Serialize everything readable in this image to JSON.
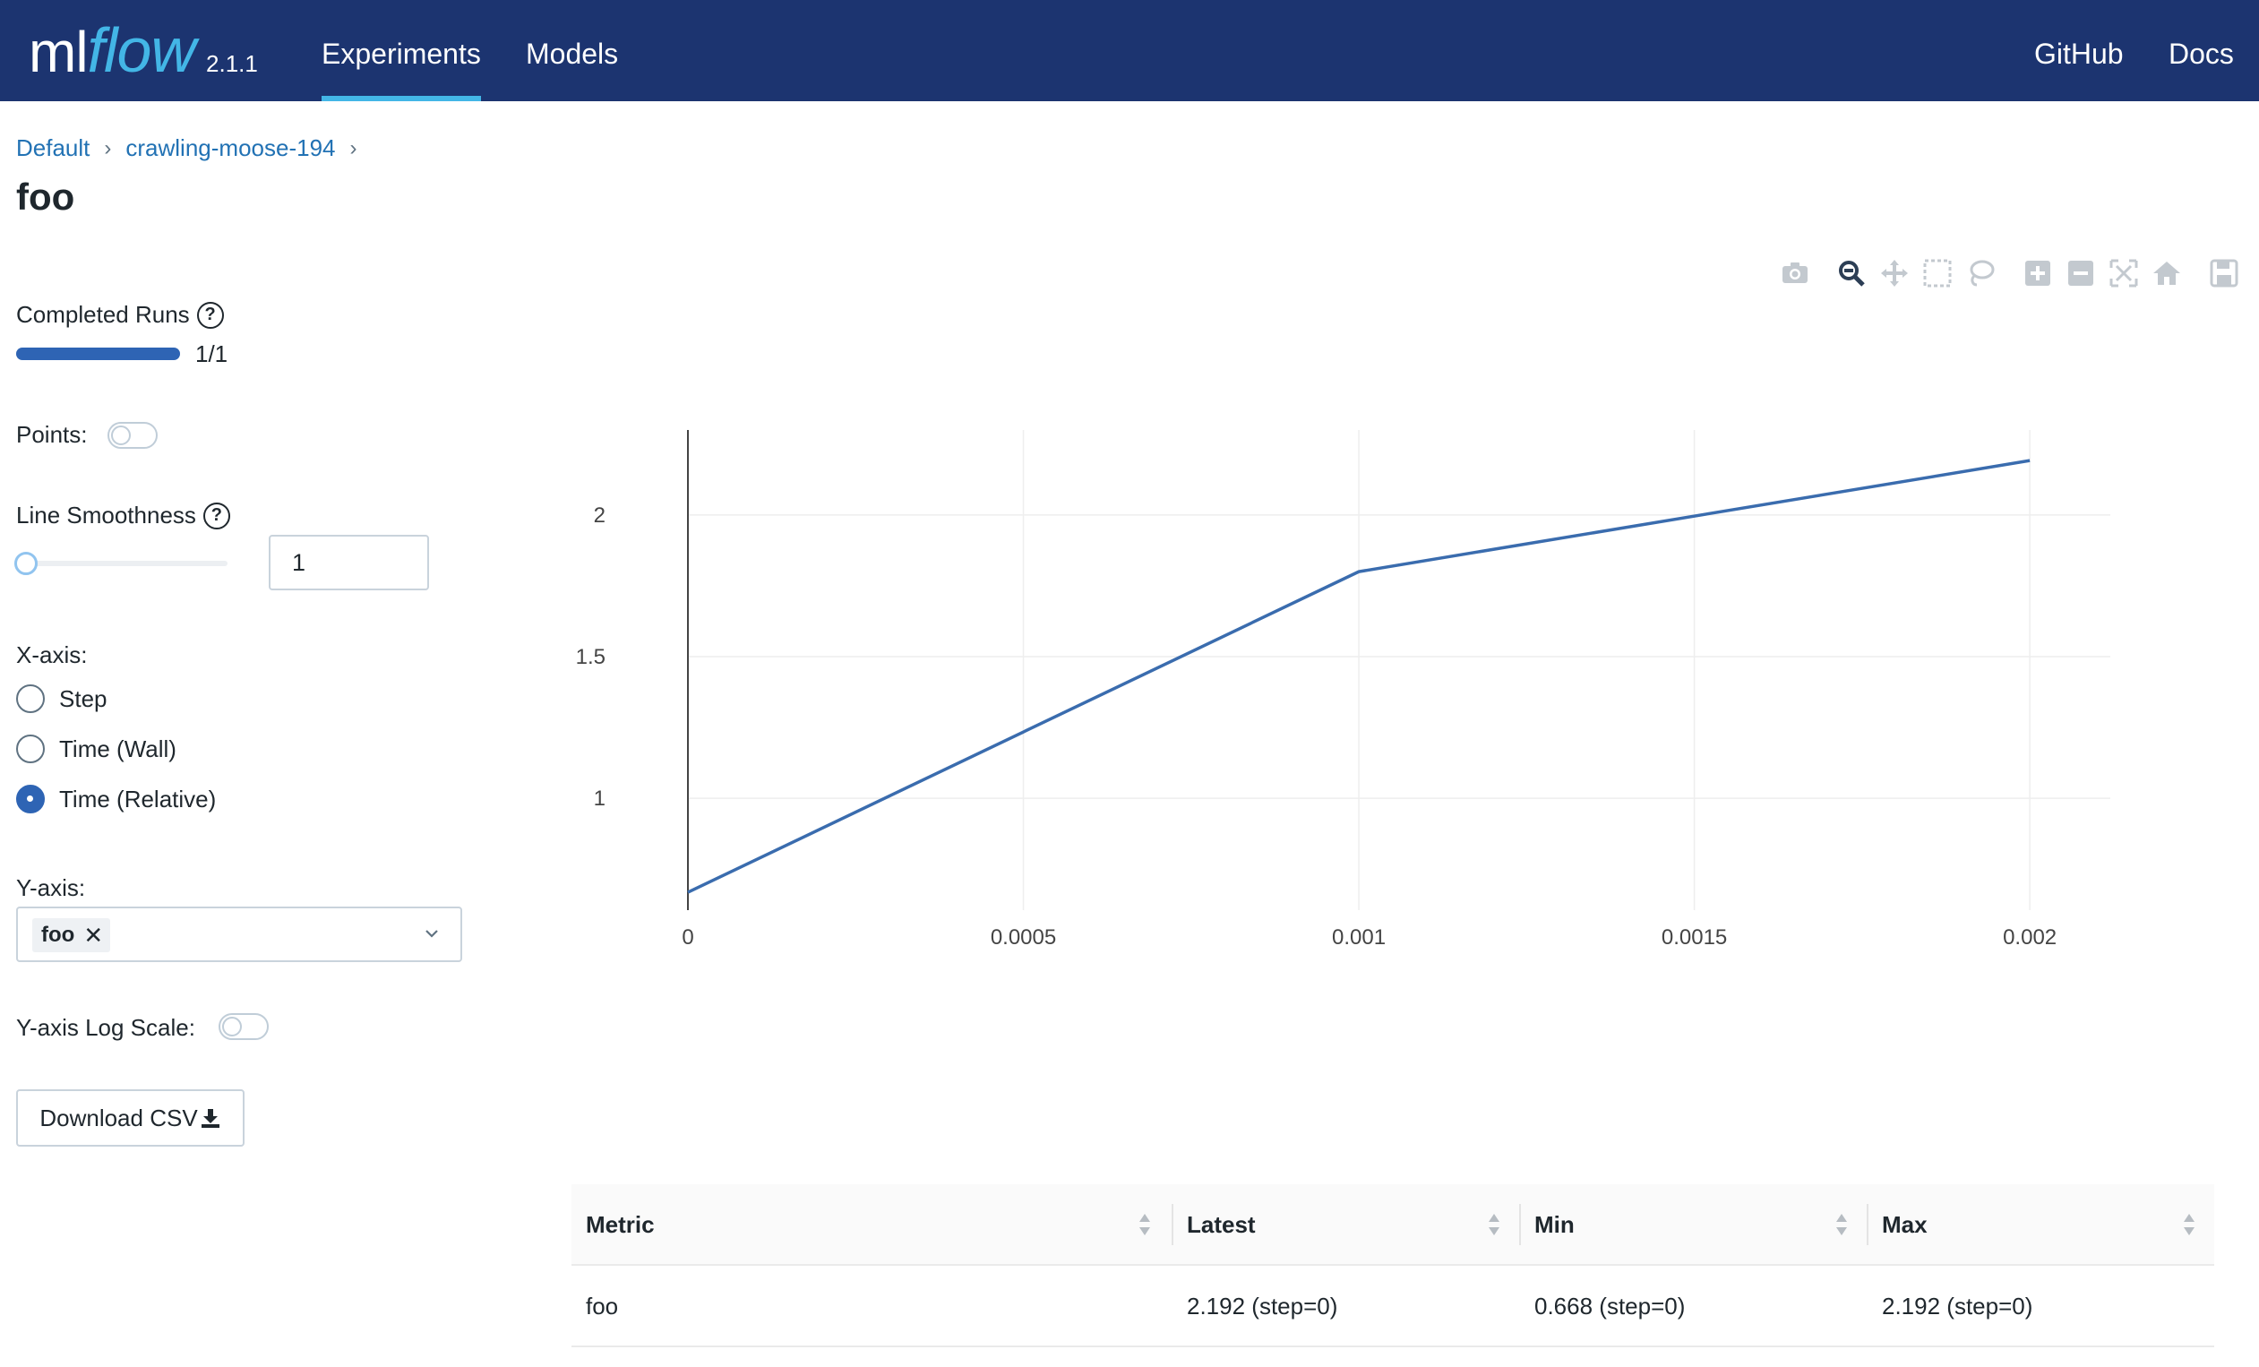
{
  "header": {
    "logo_ml": "ml",
    "logo_flow": "flow",
    "version": "2.1.1",
    "nav": [
      "Experiments",
      "Models"
    ],
    "right_links": [
      "GitHub",
      "Docs"
    ]
  },
  "breadcrumb": [
    "Default",
    "crawling-moose-194"
  ],
  "page_title": "foo",
  "controls": {
    "completed_runs_label": "Completed Runs",
    "completed_runs_value": "1/1",
    "completed_runs_fraction": 1.0,
    "points_label": "Points:",
    "points_on": false,
    "smoothness_label": "Line Smoothness",
    "smoothness_value": "1",
    "x_axis_label": "X-axis:",
    "x_axis_options": [
      "Step",
      "Time (Wall)",
      "Time (Relative)"
    ],
    "x_axis_selected": "Time (Relative)",
    "y_axis_label": "Y-axis:",
    "y_axis_selected_tag": "foo",
    "y_log_label": "Y-axis Log Scale:",
    "y_log_on": false,
    "download_label": "Download CSV"
  },
  "modebar_icons": [
    "camera-icon",
    "zoom-icon",
    "pan-icon",
    "box-select-icon",
    "lasso-icon",
    "zoom-in-icon",
    "zoom-out-icon",
    "autoscale-icon",
    "reset-axes-icon",
    "save-icon"
  ],
  "chart_data": {
    "type": "line",
    "x": [
      0,
      0.001,
      0.002
    ],
    "series": [
      {
        "values": [
          0.668,
          1.8,
          2.192
        ],
        "color": "#3a6cae"
      }
    ],
    "xticks": [
      "0",
      "0.0005",
      "0.001",
      "0.0015",
      "0.002"
    ],
    "xtick_values": [
      0,
      0.0005,
      0.001,
      0.0015,
      0.002
    ],
    "yticks": [
      "1",
      "1.5",
      "2"
    ],
    "ytick_values": [
      1,
      1.5,
      2
    ],
    "xlim": [
      0,
      0.00212
    ],
    "ylim": [
      0.605,
      2.3
    ],
    "grid": true
  },
  "table": {
    "headers": [
      "Metric",
      "Latest",
      "Min",
      "Max"
    ],
    "rows": [
      [
        "foo",
        "2.192 (step=0)",
        "0.668 (step=0)",
        "2.192 (step=0)"
      ]
    ]
  }
}
